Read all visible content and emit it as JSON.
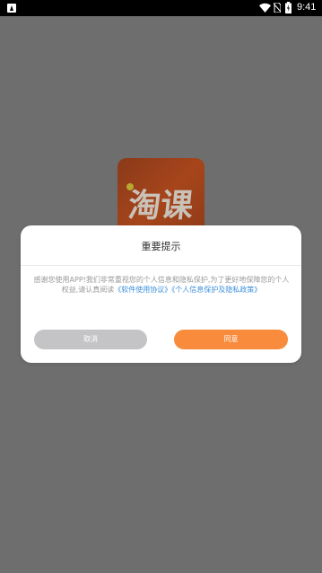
{
  "status_bar": {
    "time": "9:41",
    "icons": [
      "app-notification-icon",
      "wifi-icon",
      "no-sim-icon",
      "battery-icon"
    ]
  },
  "app": {
    "logo_text": "淘课"
  },
  "dialog": {
    "title": "重要提示",
    "body_text": "感谢您使用APP!我们非常重视您的个人信息和隐私保护,为了更好地保障您的个人权益,请认真阅读",
    "link_user_agreement": "《软件使用协议》",
    "link_privacy_policy": "《个人信息保护及隐私政策》",
    "cancel_label": "取消",
    "agree_label": "同意"
  },
  "colors": {
    "overlay": "#6e6e6e",
    "accent": "#f98b3c",
    "cancel": "#c4c4c6",
    "link": "#3b8fd9"
  }
}
